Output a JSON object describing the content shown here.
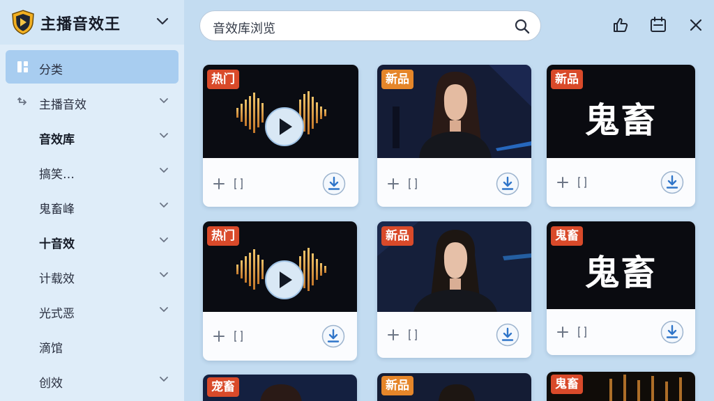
{
  "app": {
    "title": "主播音效王",
    "accent": "#a8cdf0",
    "hot_color": "#d94a2a",
    "new_color": "#e5862a"
  },
  "search": {
    "value": "音效库浏览"
  },
  "sidebar": {
    "items": [
      {
        "label": "分类",
        "icon": "category-grid-icon",
        "active": true
      },
      {
        "label": "主播音效",
        "icon": "swap-icon"
      },
      {
        "label": "音效库",
        "bold": true
      },
      {
        "label": "搞笑…"
      },
      {
        "label": "鬼畜峰"
      },
      {
        "label": "十音效",
        "bold": true
      },
      {
        "label": "计载效"
      },
      {
        "label": "光式恶"
      },
      {
        "label": "滴馆"
      },
      {
        "label": "创效"
      }
    ]
  },
  "cards": [
    {
      "tag": "热门",
      "tag_kind": "hot",
      "thumb": "waveform-play"
    },
    {
      "tag": "新品",
      "tag_kind": "new",
      "thumb": "portrait"
    },
    {
      "tag": "新品",
      "tag_kind": "hot",
      "thumb": "text",
      "big_text": "鬼畜"
    },
    {
      "tag": "热门",
      "tag_kind": "hot",
      "thumb": "waveform-play"
    },
    {
      "tag": "新品",
      "tag_kind": "hot",
      "thumb": "portrait"
    },
    {
      "tag": "鬼畜",
      "tag_kind": "hot",
      "thumb": "text",
      "big_text": "鬼畜"
    },
    {
      "tag": "宠畜",
      "tag_kind": "hot",
      "thumb": "portrait-partial"
    },
    {
      "tag": "新品",
      "tag_kind": "new",
      "thumb": "portrait-partial"
    },
    {
      "tag": "鬼畜",
      "tag_kind": "hot",
      "thumb": "lights"
    }
  ]
}
